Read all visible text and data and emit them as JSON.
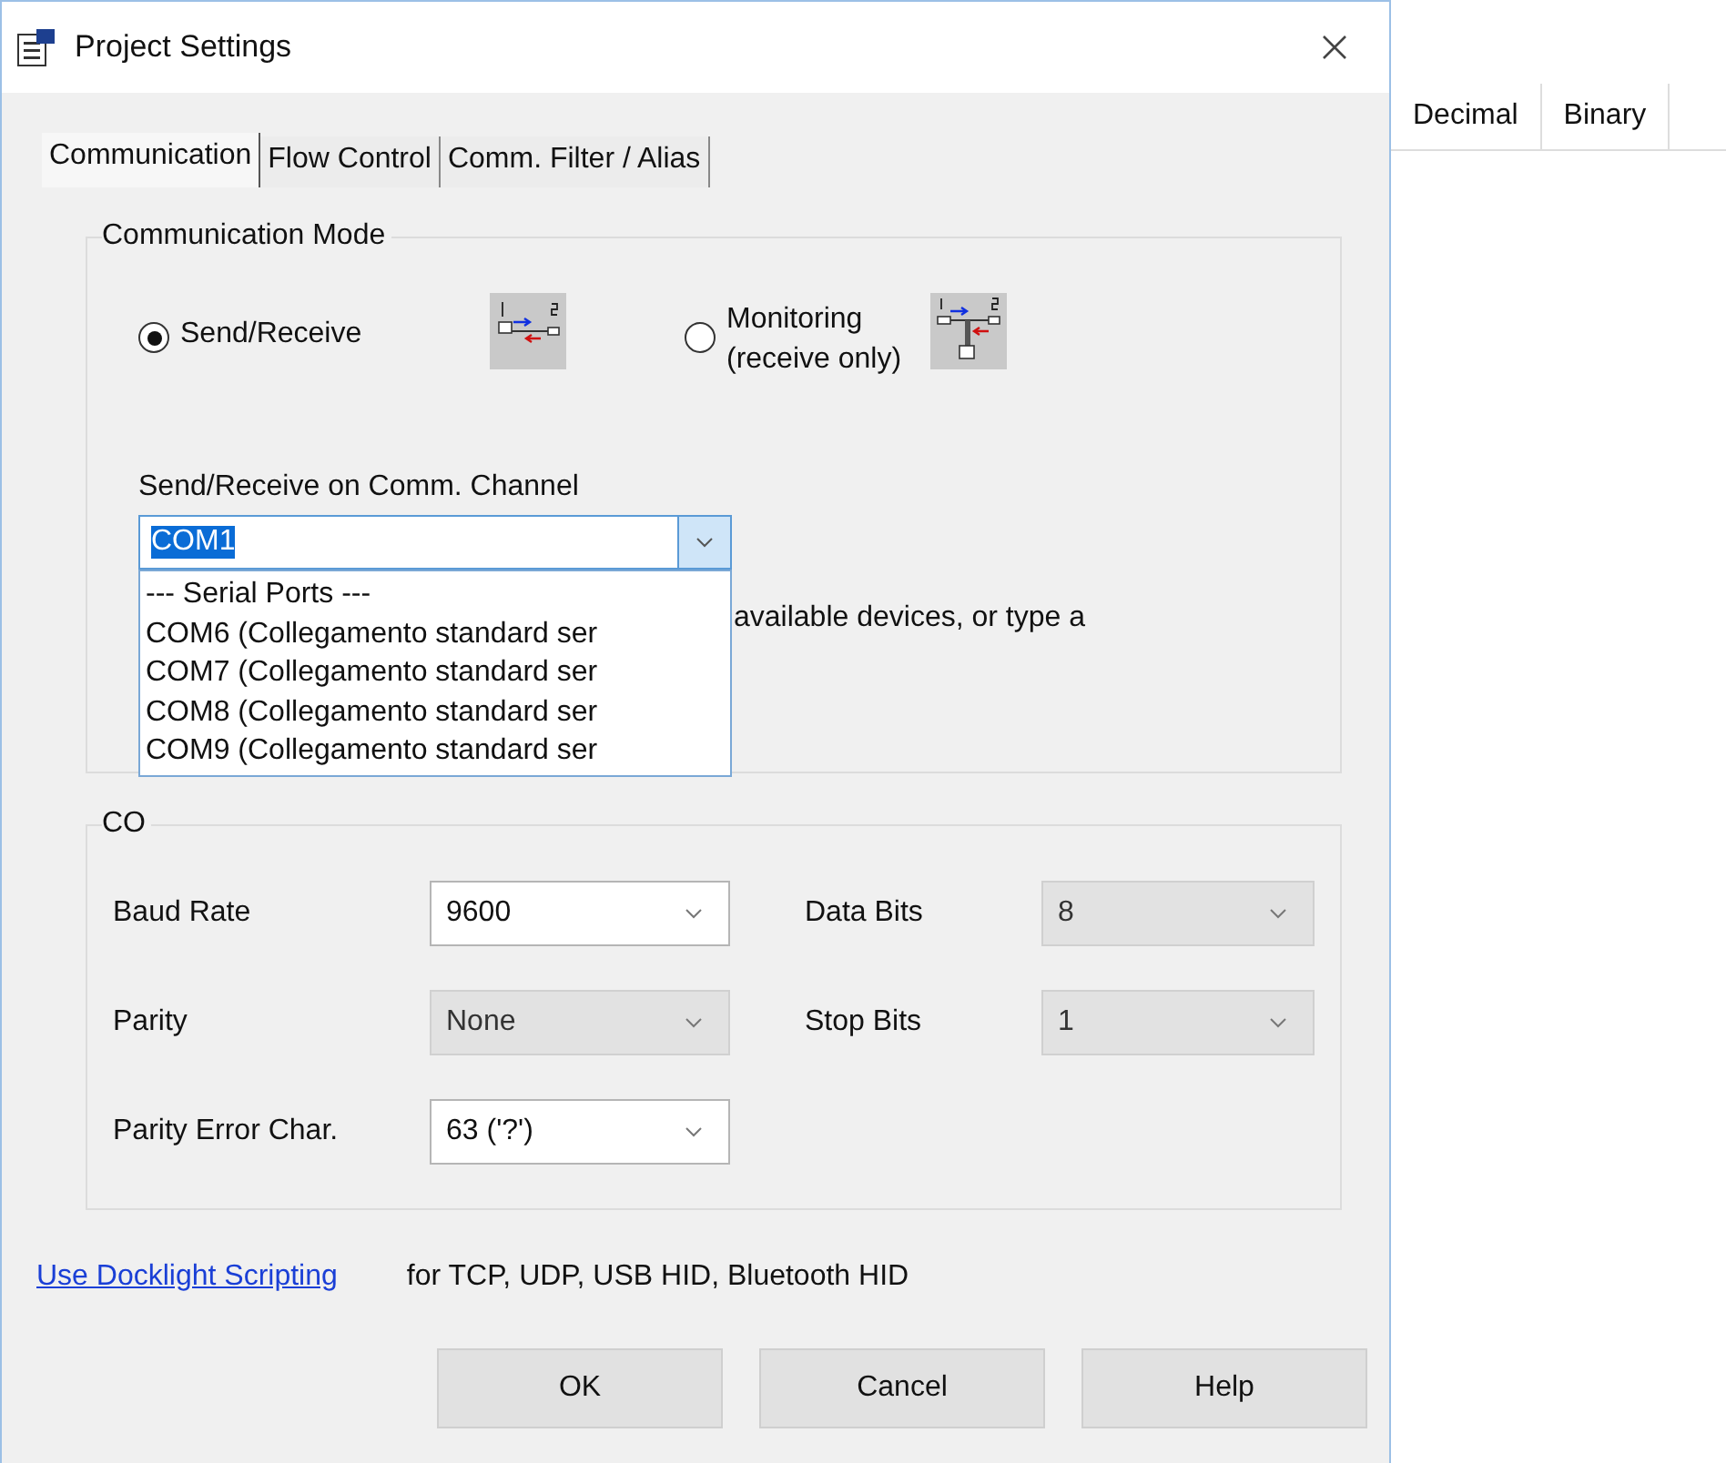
{
  "window": {
    "title": "Project Settings"
  },
  "tabs": [
    {
      "label": "Communication",
      "selected": true
    },
    {
      "label": "Flow Control",
      "selected": false
    },
    {
      "label": "Comm. Filter / Alias",
      "selected": false
    }
  ],
  "background_table": {
    "columns": [
      "Decimal",
      "Binary"
    ]
  },
  "communication_mode": {
    "title": "Communication Mode",
    "options": [
      {
        "lines": [
          "Send/Receive"
        ],
        "selected": true
      },
      {
        "lines": [
          "Monitoring",
          "(receive only)"
        ],
        "selected": false
      }
    ]
  },
  "channel": {
    "label": "Send/Receive on Comm. Channel",
    "value": "COM1",
    "expanded": true,
    "hint": "available devices, or type a",
    "options": [
      "--- Serial Ports ---",
      "COM6  (Collegamento standard ser",
      "COM7  (Collegamento standard ser",
      "COM8  (Collegamento standard ser",
      "COM9  (Collegamento standard ser"
    ]
  },
  "settings": {
    "title": "CO",
    "fields": [
      {
        "label": "Baud Rate",
        "value": "9600",
        "disabled": false
      },
      {
        "label": "Data Bits",
        "value": "8",
        "disabled": true
      },
      {
        "label": "Parity",
        "value": "None",
        "disabled": true
      },
      {
        "label": "Stop Bits",
        "value": "1",
        "disabled": true
      },
      {
        "label": "Parity Error Char.",
        "value": "63 ('?')",
        "disabled": false
      }
    ]
  },
  "scripting": {
    "link": "Use Docklight Scripting",
    "note": "for TCP, UDP, USB HID, Bluetooth HID"
  },
  "buttons": [
    "OK",
    "Cancel",
    "Help"
  ]
}
